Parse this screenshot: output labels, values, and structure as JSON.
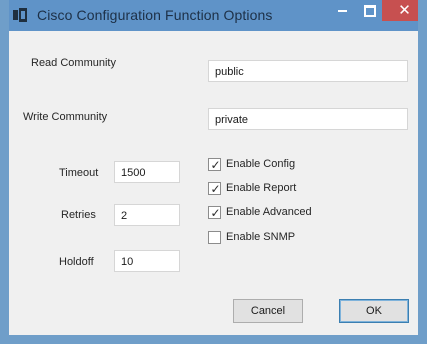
{
  "window": {
    "title": "Cisco Configuration Function Options"
  },
  "form": {
    "read_community": {
      "label": "Read Community",
      "value": "public"
    },
    "write_community": {
      "label": "Write Community",
      "value": "private"
    },
    "timeout": {
      "label": "Timeout",
      "value": "1500"
    },
    "retries": {
      "label": "Retries",
      "value": "2"
    },
    "holdoff": {
      "label": "Holdoff",
      "value": "10"
    }
  },
  "options": [
    {
      "label": "Enable Config",
      "checked": true
    },
    {
      "label": "Enable Report",
      "checked": true
    },
    {
      "label": "Enable Advanced",
      "checked": true
    },
    {
      "label": "Enable SNMP",
      "checked": false
    }
  ],
  "buttons": {
    "cancel": "Cancel",
    "ok": "OK"
  },
  "colors": {
    "titlebar": "#5f93c8",
    "close_button": "#c75050",
    "dialog_background": "#f0f0f0"
  }
}
